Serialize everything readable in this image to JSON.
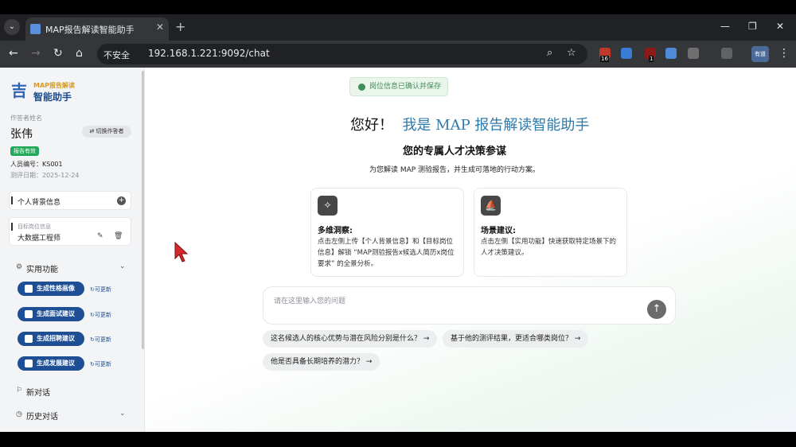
{
  "browser": {
    "tab_title": "MAP报告解读智能助手",
    "insecure_label": "不安全",
    "url": "192.168.1.221:9092/chat",
    "ext_badge_1": "16",
    "ext_badge_2": "1",
    "profile_label": "有道"
  },
  "sidebar": {
    "logo_sub": "MAP报告解读",
    "logo_main": "智能助手",
    "respondent_label": "作答者姓名",
    "respondent_name": "张伟",
    "switch_label": "切换作答者",
    "report_status": "报告有效",
    "id_text": "人员编号：KS001",
    "date_text": "测评日期：2025-12-24",
    "background_label": "个人背景信息",
    "target_label": "目标岗位信息",
    "target_value": "大数据工程师",
    "functions_heading": "实用功能",
    "function_buttons": [
      {
        "label": "生成性格画像",
        "tag": "可更新"
      },
      {
        "label": "生成面试建议",
        "tag": "可更新"
      },
      {
        "label": "生成招聘建议",
        "tag": "可更新"
      },
      {
        "label": "生成发展建议",
        "tag": "可更新"
      }
    ],
    "new_chat": "新对话",
    "history": "历史对话"
  },
  "main": {
    "toast": "岗位信息已确认并保存",
    "greet_hello": "您好！",
    "greet_name": "我是 MAP 报告解读智能助手",
    "subtitle": "您的专属人才决策参谋",
    "description": "为您解读 MAP 测验报告，并生成可落地的行动方案。",
    "features": [
      {
        "title": "多维洞察:",
        "desc": "点击左侧上传【个人背景信息】和【目标岗位信息】解锁 “MAP测验报告x候选人简历x岗位要求” 的全景分析。"
      },
      {
        "title": "场景建议:",
        "desc": "点击左侧【实用功能】快速获取特定场景下的人才决策建议。"
      }
    ],
    "input_placeholder": "请在这里输入您的问题",
    "suggestions": [
      "这名候选人的核心优势与潜在风险分别是什么？",
      "基于他的测评结果，更适合哪类岗位？",
      "他是否具备长期培养的潜力？"
    ]
  }
}
